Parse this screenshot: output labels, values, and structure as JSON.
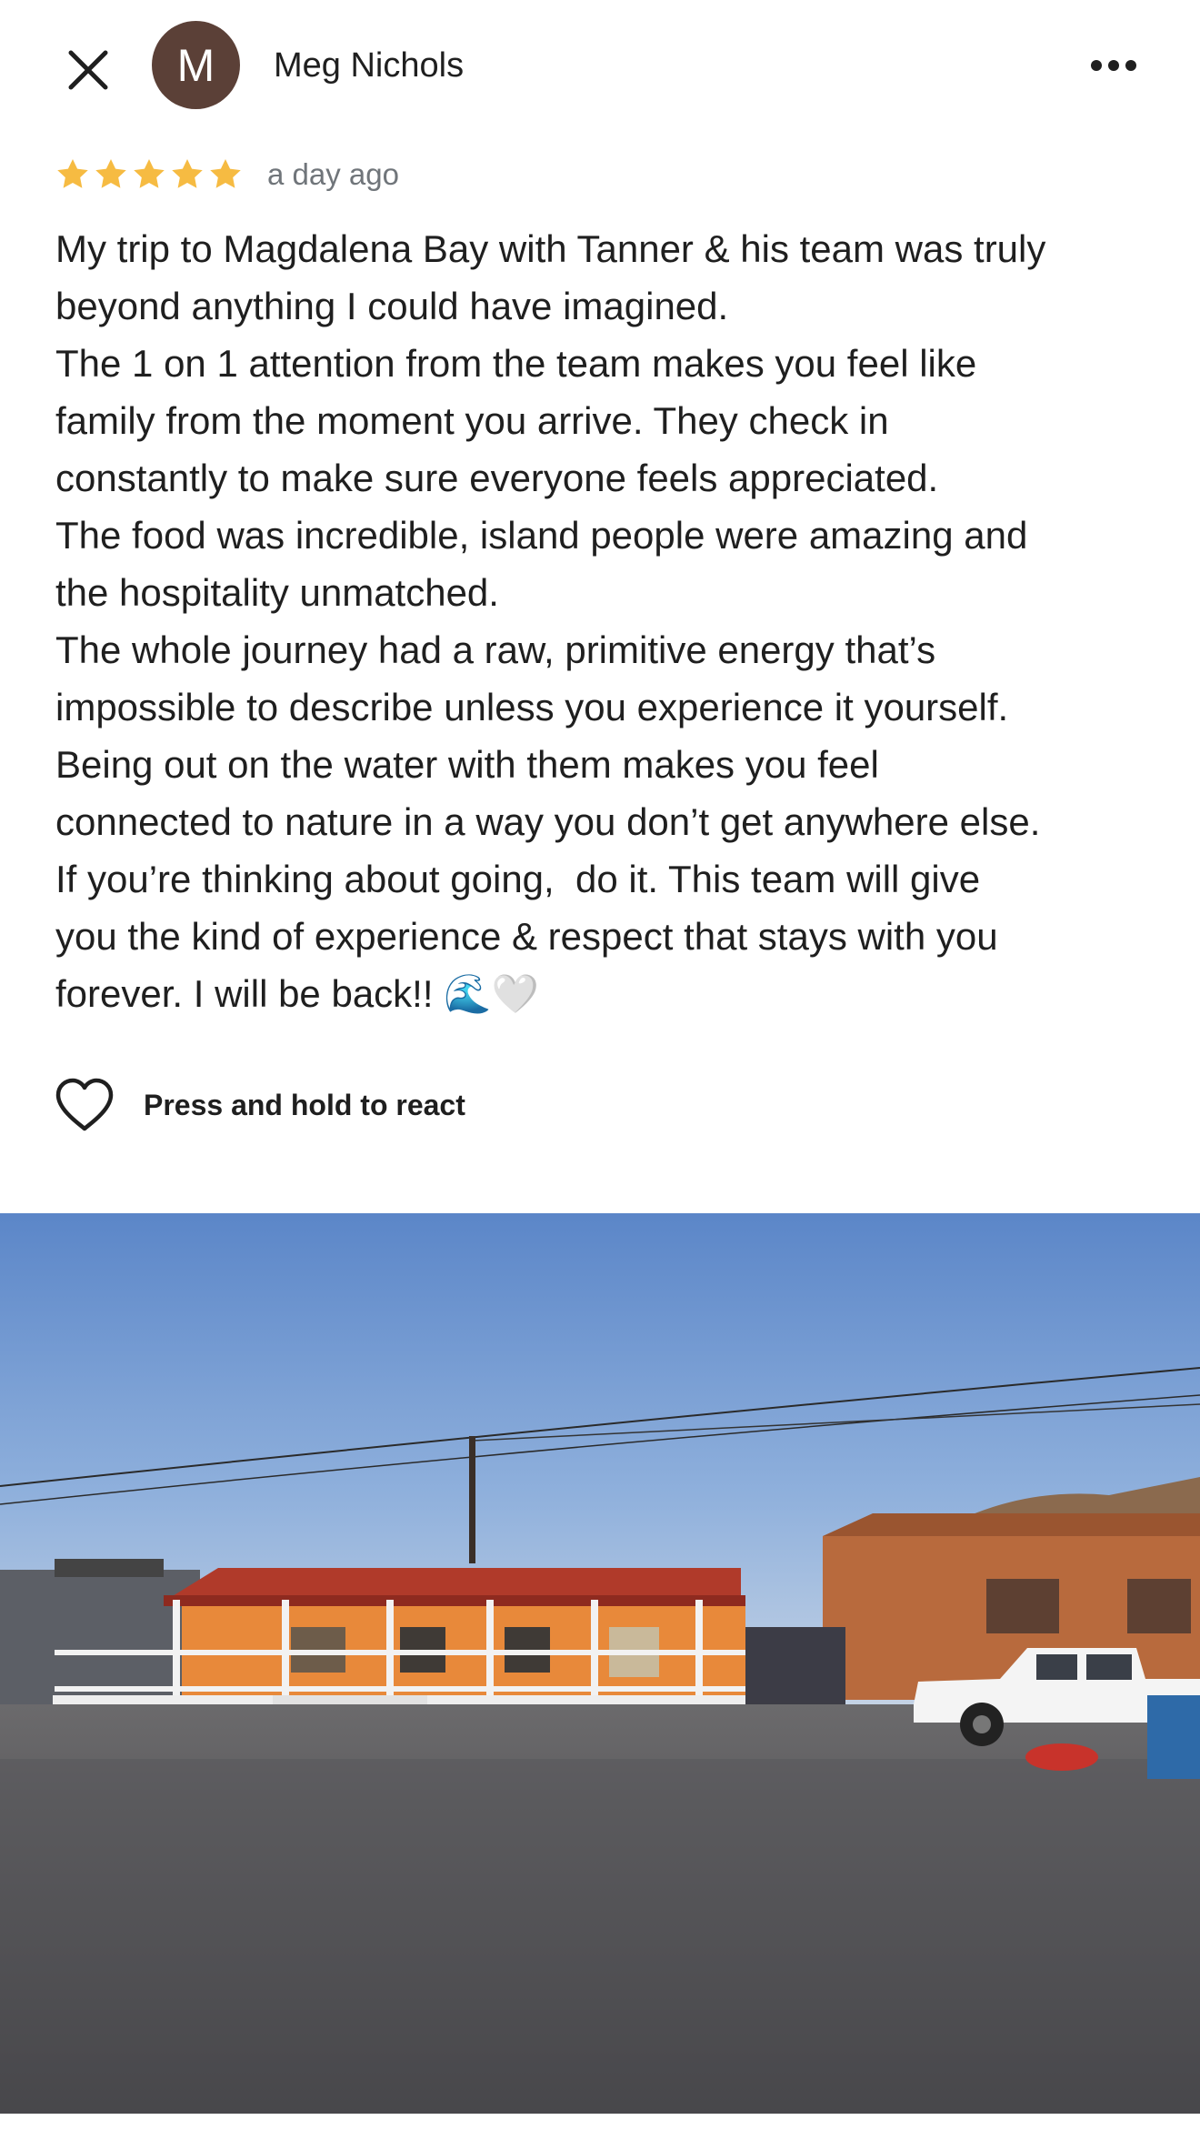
{
  "header": {
    "close_icon": "close-icon",
    "avatar_initial": "M",
    "avatar_color": "#5b4037",
    "author_name": "Meg Nichols",
    "more_icon": "more-horizontal-icon"
  },
  "review": {
    "rating": 5,
    "rating_max": 5,
    "star_color": "#f6bb42",
    "timestamp": "a day ago",
    "text": "My trip to Magdalena Bay with Tanner & his team was truly\nbeyond anything I could have imagined.\nThe 1 on 1 attention from the team makes you feel like\nfamily from the moment you arrive. They check in\nconstantly to make sure everyone feels appreciated.\nThe food was incredible, island people were amazing and\nthe hospitality unmatched.\nThe whole journey had a raw, primitive energy that’s\nimpossible to describe unless you experience it yourself.\nBeing out on the water with them makes you feel\nconnected to nature in a way you don’t get anywhere else.\nIf you’re thinking about going,  do it. This team will give\nyou the kind of experience & respect that stays with you\nforever. I will be back!! 🌊🤍"
  },
  "reaction": {
    "icon": "heart-outline-icon",
    "label": "Press and hold to react"
  },
  "photo": {
    "description_icon": "review-photo"
  }
}
